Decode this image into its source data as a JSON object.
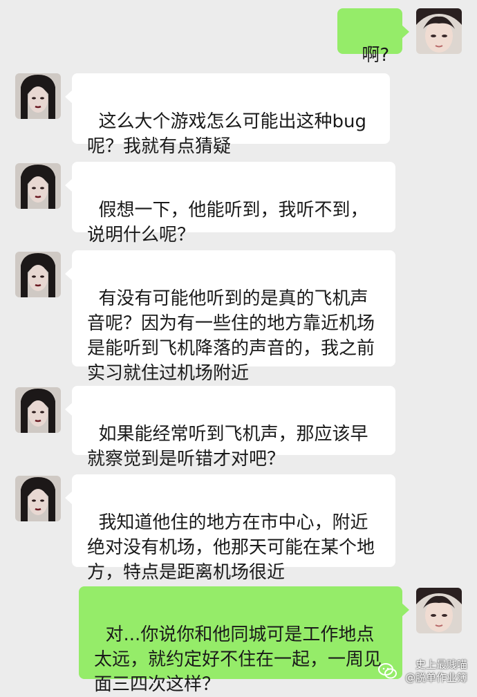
{
  "messages": [
    {
      "side": "out",
      "text": "啊?"
    },
    {
      "side": "in",
      "text": "这么大个游戏怎么可能出这种bug呢？我就有点猜疑"
    },
    {
      "side": "in",
      "text": "假想一下，他能听到，我听不到，说明什么呢？"
    },
    {
      "side": "in",
      "text": "有没有可能他听到的是真的飞机声音呢？因为有一些住的地方靠近机场是能听到飞机降落的声音的，我之前实习就住过机场附近"
    },
    {
      "side": "in",
      "text": "如果能经常听到飞机声，那应该早就察觉到是听错才对吧？"
    },
    {
      "side": "in",
      "text": "我知道他住的地方在市中心，附近绝对没有机场，他那天可能在某个地方，特点是距离机场很近"
    },
    {
      "side": "out",
      "text": "对...你说你和他同城可是工作地点太远，就约定好不住在一起，一周见面三四次这样？"
    }
  ],
  "watermark": {
    "line1": "史上最贱喵",
    "line2": "@脱单作业簿",
    "icon": "wechat-icon"
  },
  "colors": {
    "background": "#ececec",
    "incoming_bubble": "#ffffff",
    "outgoing_bubble": "#95ec69"
  }
}
